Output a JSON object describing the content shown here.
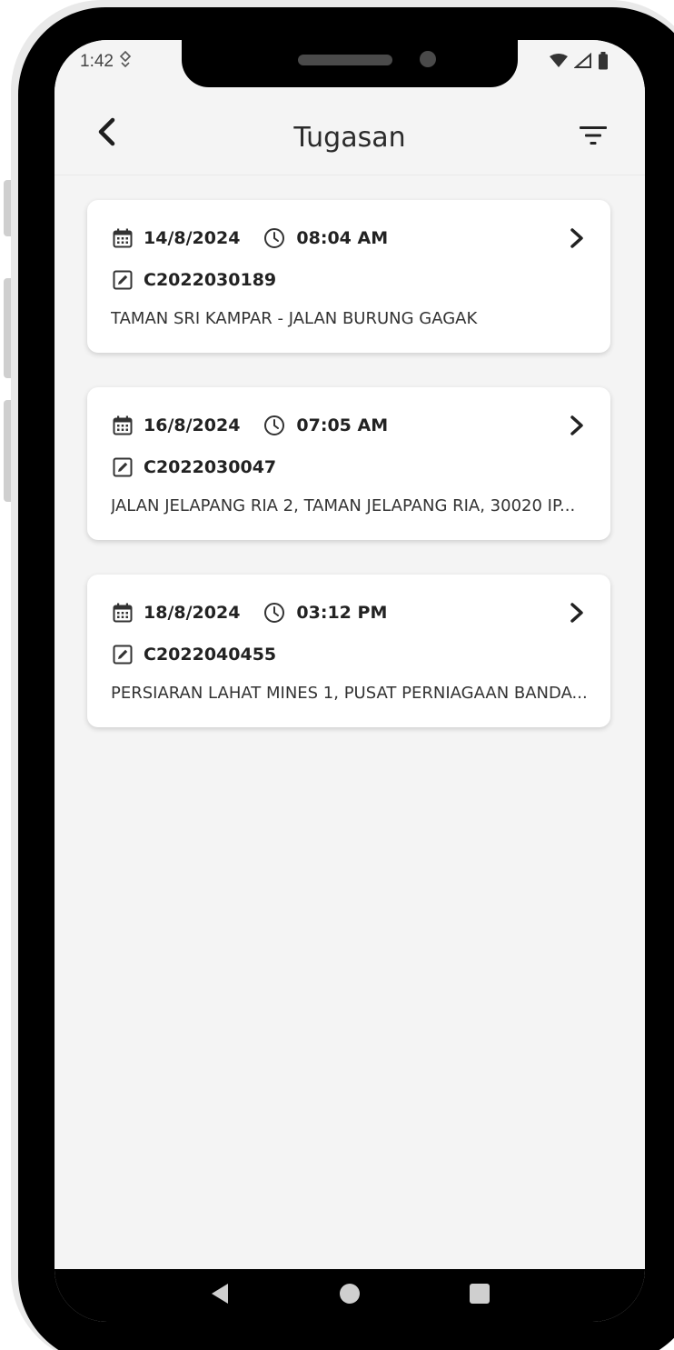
{
  "status_bar": {
    "time": "1:42",
    "icons": [
      "location-icon",
      "wifi-icon",
      "signal-icon",
      "battery-icon"
    ]
  },
  "app_bar": {
    "title": "Tugasan",
    "back_icon": "chevron-left-icon",
    "filter_icon": "filter-icon"
  },
  "tasks": [
    {
      "date": "14/8/2024",
      "time": "08:04 AM",
      "code": "C2022030189",
      "address": "TAMAN SRI KAMPAR - JALAN BURUNG GAGAK"
    },
    {
      "date": "16/8/2024",
      "time": "07:05 AM",
      "code": "C2022030047",
      "address": "JALAN JELAPANG RIA 2, TAMAN JELAPANG RIA, 30020 IP..."
    },
    {
      "date": "18/8/2024",
      "time": "03:12 PM",
      "code": "C2022040455",
      "address": "PERSIARAN LAHAT MINES 1, PUSAT PERNIAGAAN BANDA..."
    }
  ],
  "nav_bar": {
    "icons": [
      "back-triangle-icon",
      "home-circle-icon",
      "recents-square-icon"
    ]
  },
  "colors": {
    "screen_bg": "#f4f4f4",
    "card_bg": "#ffffff",
    "text": "#222222"
  }
}
